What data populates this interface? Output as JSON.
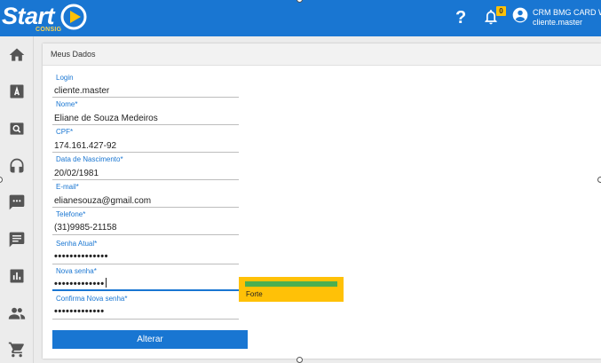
{
  "header": {
    "logo_text": "Start",
    "logo_sub": "CONSIG",
    "help_icon": "help-icon",
    "notification_count": "0",
    "user_company": "CRM BMG CARD WS",
    "user_name": "cliente.master"
  },
  "sidebar": {
    "icons": [
      "home-icon",
      "text-icon",
      "search-icon",
      "headset-icon",
      "chat-icon",
      "message-icon",
      "chart-icon",
      "people-icon",
      "cart-icon"
    ]
  },
  "page": {
    "title": "Meus Dados"
  },
  "form": {
    "login_label": "Login",
    "login_value": "cliente.master",
    "nome_label": "Nome*",
    "nome_value": "Eliane de Souza Medeiros",
    "cpf_label": "CPF*",
    "cpf_value": "174.161.427-92",
    "nascimento_label": "Data de Nascimento*",
    "nascimento_value": "20/02/1981",
    "email_label": "E-mail*",
    "email_value": "elianesouza@gmail.com",
    "telefone_label": "Telefone*",
    "telefone_value": "(31)9985-21158",
    "senha_atual_label": "Senha Atual*",
    "senha_atual_value": "••••••••••••••",
    "nova_senha_label": "Nova senha*",
    "nova_senha_value": "•••••••••••••",
    "confirma_label": "Confirma Nova senha*",
    "confirma_value": "•••••••••••••",
    "strength_label": "Forte",
    "strength_level": 1.0,
    "submit_label": "Alterar"
  },
  "colors": {
    "primary": "#1976d2",
    "strength_bg": "#ffc107",
    "strength_bar": "#4caf50"
  }
}
